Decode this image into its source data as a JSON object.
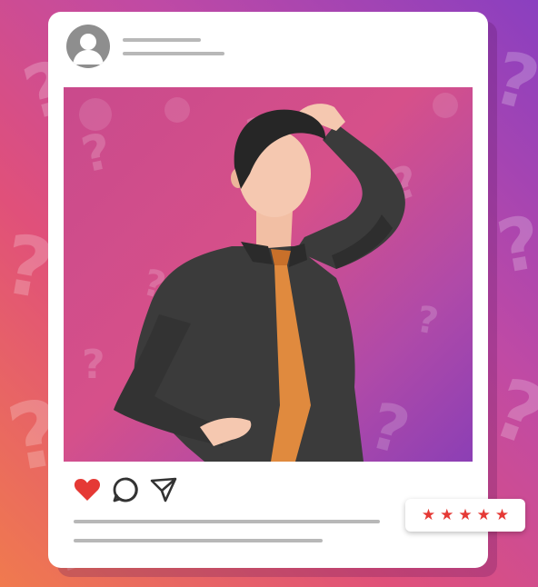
{
  "post": {
    "avatar_icon": "user-avatar-icon",
    "action_icons": [
      "heart-icon",
      "comment-icon",
      "share-icon"
    ],
    "liked": true,
    "like_color": "#e53935"
  },
  "rating": {
    "stars": 5,
    "max": 5,
    "star_color": "#e53935"
  },
  "colors": {
    "card": "#ffffff",
    "placeholder_line": "#b8b8b8",
    "tie": "#e08a3e",
    "suit": "#3b3b3b",
    "skin": "#f5c8b0",
    "hair": "#262626"
  }
}
